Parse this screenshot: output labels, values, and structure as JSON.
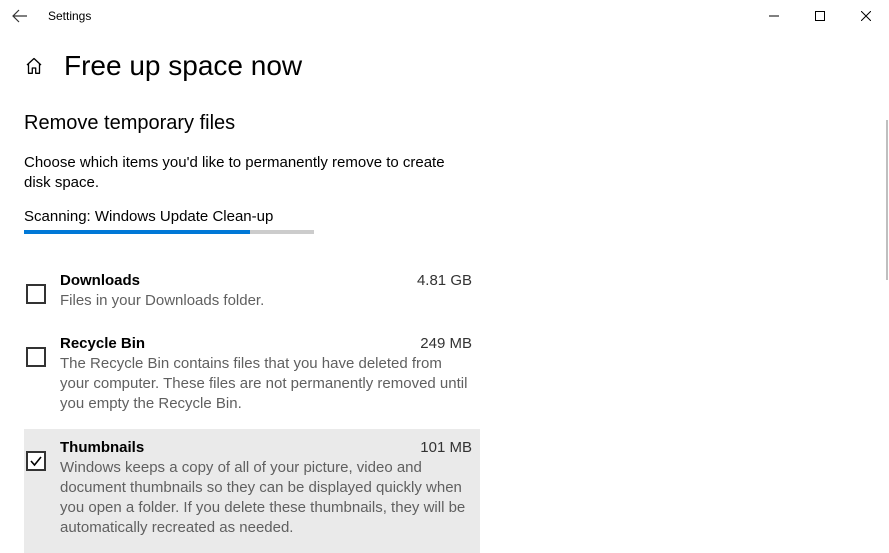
{
  "titlebar": {
    "app_title": "Settings"
  },
  "header": {
    "page_title": "Free up space now"
  },
  "section": {
    "title": "Remove temporary files",
    "description": "Choose which items you'd like to permanently remove to create disk space.",
    "scan_status": "Scanning: Windows Update Clean-up",
    "progress_percent": 78
  },
  "items": [
    {
      "title": "Downloads",
      "size": "4.81 GB",
      "description": "Files in your Downloads folder.",
      "checked": false,
      "hover": false
    },
    {
      "title": "Recycle Bin",
      "size": "249 MB",
      "description": "The Recycle Bin contains files that you have deleted from your computer. These files are not permanently removed until you empty the Recycle Bin.",
      "checked": false,
      "hover": false
    },
    {
      "title": "Thumbnails",
      "size": "101 MB",
      "description": "Windows keeps a copy of all of your picture, video and document thumbnails so they can be displayed quickly when you open a folder. If you delete these thumbnails, they will be automatically recreated as needed.",
      "checked": true,
      "hover": true
    }
  ]
}
